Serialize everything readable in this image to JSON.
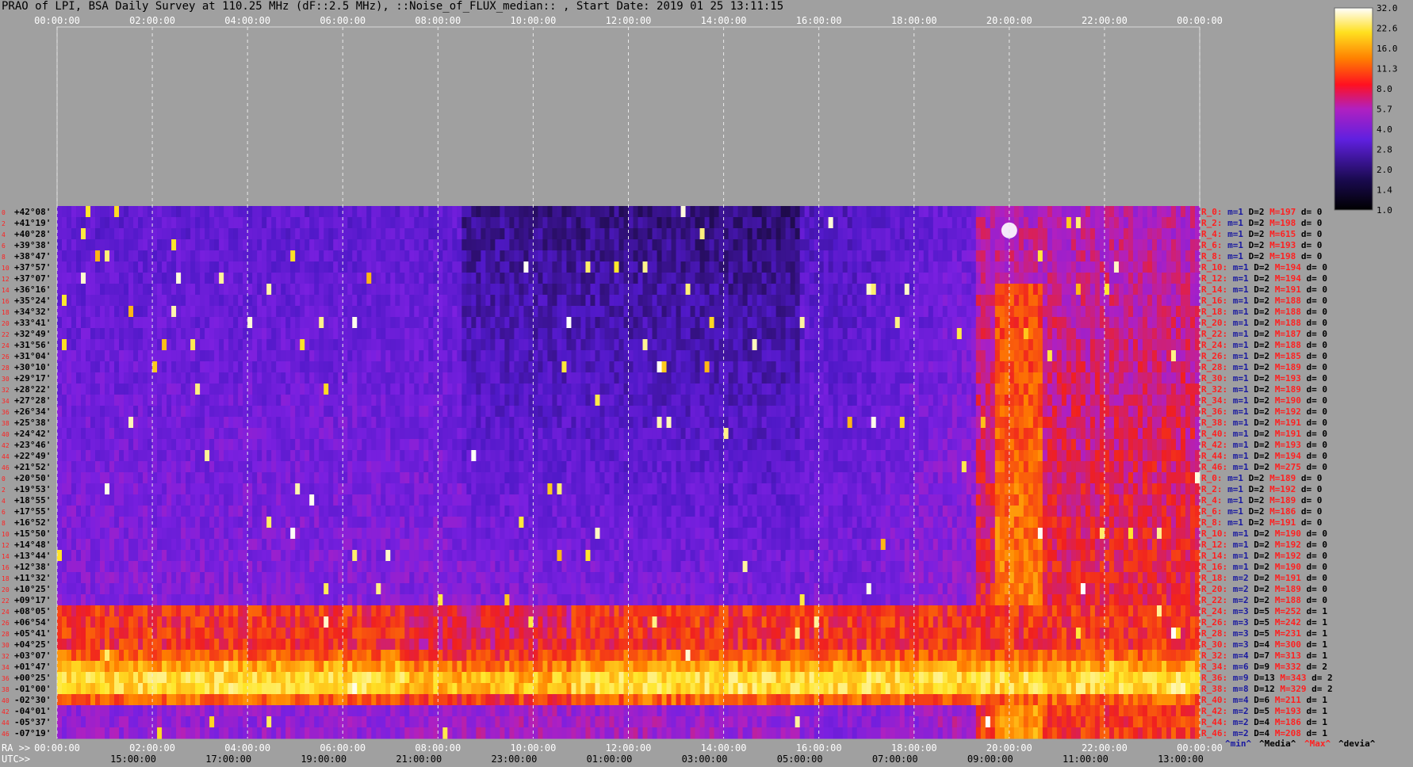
{
  "title": "PRAO of LPI, BSA Daily Survey at 110.25 MHz (dF::2.5 MHz), ::Noise_of_FLUX_median:: , Start Date: 2019 01 25 13:11:15",
  "axis": {
    "top_ticks": [
      "00:00:00",
      "02:00:00",
      "04:00:00",
      "06:00:00",
      "08:00:00",
      "10:00:00",
      "12:00:00",
      "14:00:00",
      "16:00:00",
      "18:00:00",
      "20:00:00",
      "22:00:00",
      "00:00:00"
    ],
    "ra_prefix": "RA >>",
    "ra_ticks": [
      "00:00:00",
      "02:00:00",
      "04:00:00",
      "06:00:00",
      "08:00:00",
      "10:00:00",
      "12:00:00",
      "14:00:00",
      "16:00:00",
      "18:00:00",
      "20:00:00",
      "22:00:00",
      "00:00:00"
    ],
    "utc_prefix": "UTC>>",
    "utc_ticks": [
      "15:00:00",
      "17:00:00",
      "19:00:00",
      "21:00:00",
      "23:00:00",
      "01:00:00",
      "03:00:00",
      "05:00:00",
      "07:00:00",
      "09:00:00",
      "11:00:00",
      "13:00:00"
    ]
  },
  "colorbar": {
    "ticks": [
      "32.0",
      "22.6",
      "16.0",
      "11.3",
      "8.0",
      "5.7",
      "4.0",
      "2.8",
      "2.0",
      "1.4",
      "1.0"
    ]
  },
  "stats_legend": [
    {
      "text": "^min^",
      "color": "#1a1aa0"
    },
    {
      "text": "^Media^",
      "color": "#000000"
    },
    {
      "text": "^Max^",
      "color": "#ff2020"
    },
    {
      "text": "^devia^",
      "color": "#000000"
    }
  ],
  "colors": {
    "background": "#a0a0a0",
    "dark": "#1a0a40",
    "violet": "#7a20e0",
    "magenta": "#c020b0",
    "red": "#f02020",
    "orange": "#ff9000",
    "yellow": "#ffff40",
    "white": "#ffffff",
    "row_label": "#ff2020",
    "dec_label": "#000000"
  },
  "chart_data": {
    "type": "heatmap",
    "title": "PRAO of LPI, BSA Daily Survey at 110.25 MHz (dF::2.5 MHz), ::Noise_of_FLUX_median:: , Start Date: 2019 01 25 13:11:15",
    "colorbar_ticks": [
      32.0,
      22.6,
      16.0,
      11.3,
      8.0,
      5.7,
      4.0,
      2.8,
      2.0,
      1.4,
      1.0
    ],
    "rows": [
      {
        "idx": "0",
        "dec": "+42°08'",
        "r": "R_0:",
        "m": 1,
        "D": 2,
        "M": 197,
        "d": 0
      },
      {
        "idx": "2",
        "dec": "+41°19'",
        "r": "R_2:",
        "m": 1,
        "D": 2,
        "M": 198,
        "d": 0
      },
      {
        "idx": "4",
        "dec": "+40°28'",
        "r": "R_4:",
        "m": 1,
        "D": 2,
        "M": 615,
        "d": 0
      },
      {
        "idx": "6",
        "dec": "+39°38'",
        "r": "R_6:",
        "m": 1,
        "D": 2,
        "M": 193,
        "d": 0
      },
      {
        "idx": "8",
        "dec": "+38°47'",
        "r": "R_8:",
        "m": 1,
        "D": 2,
        "M": 198,
        "d": 0
      },
      {
        "idx": "10",
        "dec": "+37°57'",
        "r": "R_10:",
        "m": 1,
        "D": 2,
        "M": 194,
        "d": 0
      },
      {
        "idx": "12",
        "dec": "+37°07'",
        "r": "R_12:",
        "m": 1,
        "D": 2,
        "M": 194,
        "d": 0
      },
      {
        "idx": "14",
        "dec": "+36°16'",
        "r": "R_14:",
        "m": 1,
        "D": 2,
        "M": 191,
        "d": 0
      },
      {
        "idx": "16",
        "dec": "+35°24'",
        "r": "R_16:",
        "m": 1,
        "D": 2,
        "M": 188,
        "d": 0
      },
      {
        "idx": "18",
        "dec": "+34°32'",
        "r": "R_18:",
        "m": 1,
        "D": 2,
        "M": 188,
        "d": 0
      },
      {
        "idx": "20",
        "dec": "+33°41'",
        "r": "R_20:",
        "m": 1,
        "D": 2,
        "M": 188,
        "d": 0
      },
      {
        "idx": "22",
        "dec": "+32°49'",
        "r": "R_22:",
        "m": 1,
        "D": 2,
        "M": 187,
        "d": 0
      },
      {
        "idx": "24",
        "dec": "+31°56'",
        "r": "R_24:",
        "m": 1,
        "D": 2,
        "M": 188,
        "d": 0
      },
      {
        "idx": "26",
        "dec": "+31°04'",
        "r": "R_26:",
        "m": 1,
        "D": 2,
        "M": 185,
        "d": 0
      },
      {
        "idx": "28",
        "dec": "+30°10'",
        "r": "R_28:",
        "m": 1,
        "D": 2,
        "M": 189,
        "d": 0
      },
      {
        "idx": "30",
        "dec": "+29°17'",
        "r": "R_30:",
        "m": 1,
        "D": 2,
        "M": 193,
        "d": 0
      },
      {
        "idx": "32",
        "dec": "+28°22'",
        "r": "R_32:",
        "m": 1,
        "D": 2,
        "M": 189,
        "d": 0
      },
      {
        "idx": "34",
        "dec": "+27°28'",
        "r": "R_34:",
        "m": 1,
        "D": 2,
        "M": 190,
        "d": 0
      },
      {
        "idx": "36",
        "dec": "+26°34'",
        "r": "R_36:",
        "m": 1,
        "D": 2,
        "M": 192,
        "d": 0
      },
      {
        "idx": "38",
        "dec": "+25°38'",
        "r": "R_38:",
        "m": 1,
        "D": 2,
        "M": 191,
        "d": 0
      },
      {
        "idx": "40",
        "dec": "+24°42'",
        "r": "R_40:",
        "m": 1,
        "D": 2,
        "M": 191,
        "d": 0
      },
      {
        "idx": "42",
        "dec": "+23°46'",
        "r": "R_42:",
        "m": 1,
        "D": 2,
        "M": 193,
        "d": 0
      },
      {
        "idx": "44",
        "dec": "+22°49'",
        "r": "R_44:",
        "m": 1,
        "D": 2,
        "M": 194,
        "d": 0
      },
      {
        "idx": "46",
        "dec": "+21°52'",
        "r": "R_46:",
        "m": 1,
        "D": 2,
        "M": 275,
        "d": 0
      },
      {
        "idx": "0",
        "dec": "+20°50'",
        "r": "R_0:",
        "m": 1,
        "D": 2,
        "M": 189,
        "d": 0
      },
      {
        "idx": "2",
        "dec": "+19°53'",
        "r": "R_2:",
        "m": 1,
        "D": 2,
        "M": 192,
        "d": 0
      },
      {
        "idx": "4",
        "dec": "+18°55'",
        "r": "R_4:",
        "m": 1,
        "D": 2,
        "M": 189,
        "d": 0
      },
      {
        "idx": "6",
        "dec": "+17°55'",
        "r": "R_6:",
        "m": 1,
        "D": 2,
        "M": 186,
        "d": 0
      },
      {
        "idx": "8",
        "dec": "+16°52'",
        "r": "R_8:",
        "m": 1,
        "D": 2,
        "M": 191,
        "d": 0
      },
      {
        "idx": "10",
        "dec": "+15°50'",
        "r": "R_10:",
        "m": 1,
        "D": 2,
        "M": 190,
        "d": 0
      },
      {
        "idx": "12",
        "dec": "+14°48'",
        "r": "R_12:",
        "m": 1,
        "D": 2,
        "M": 192,
        "d": 0
      },
      {
        "idx": "14",
        "dec": "+13°44'",
        "r": "R_14:",
        "m": 1,
        "D": 2,
        "M": 192,
        "d": 0
      },
      {
        "idx": "16",
        "dec": "+12°38'",
        "r": "R_16:",
        "m": 1,
        "D": 2,
        "M": 190,
        "d": 0
      },
      {
        "idx": "18",
        "dec": "+11°32'",
        "r": "R_18:",
        "m": 2,
        "D": 2,
        "M": 191,
        "d": 0
      },
      {
        "idx": "20",
        "dec": "+10°25'",
        "r": "R_20:",
        "m": 2,
        "D": 2,
        "M": 189,
        "d": 0
      },
      {
        "idx": "22",
        "dec": "+09°17'",
        "r": "R_22:",
        "m": 2,
        "D": 2,
        "M": 188,
        "d": 0
      },
      {
        "idx": "24",
        "dec": "+08°05'",
        "r": "R_24:",
        "m": 3,
        "D": 5,
        "M": 252,
        "d": 1
      },
      {
        "idx": "26",
        "dec": "+06°54'",
        "r": "R_26:",
        "m": 3,
        "D": 5,
        "M": 242,
        "d": 1
      },
      {
        "idx": "28",
        "dec": "+05°41'",
        "r": "R_28:",
        "m": 3,
        "D": 5,
        "M": 231,
        "d": 1
      },
      {
        "idx": "30",
        "dec": "+04°25'",
        "r": "R_30:",
        "m": 3,
        "D": 4,
        "M": 300,
        "d": 1
      },
      {
        "idx": "32",
        "dec": "+03°07'",
        "r": "R_32:",
        "m": 4,
        "D": 7,
        "M": 313,
        "d": 1
      },
      {
        "idx": "34",
        "dec": "+01°47'",
        "r": "R_34:",
        "m": 6,
        "D": 9,
        "M": 332,
        "d": 2
      },
      {
        "idx": "36",
        "dec": "+00°25'",
        "r": "R_36:",
        "m": 9,
        "D": 13,
        "M": 343,
        "d": 2
      },
      {
        "idx": "38",
        "dec": "-01°00'",
        "r": "R_38:",
        "m": 8,
        "D": 12,
        "M": 329,
        "d": 2
      },
      {
        "idx": "40",
        "dec": "-02°30'",
        "r": "R_40:",
        "m": 4,
        "D": 6,
        "M": 211,
        "d": 1
      },
      {
        "idx": "42",
        "dec": "-04°01'",
        "r": "R_42:",
        "m": 2,
        "D": 5,
        "M": 193,
        "d": 1
      },
      {
        "idx": "44",
        "dec": "-05°37'",
        "r": "R_44:",
        "m": 2,
        "D": 4,
        "M": 186,
        "d": 1
      },
      {
        "idx": "46",
        "dec": "-07°19'",
        "r": "R_46:",
        "m": 2,
        "D": 4,
        "M": 208,
        "d": 1
      }
    ]
  }
}
